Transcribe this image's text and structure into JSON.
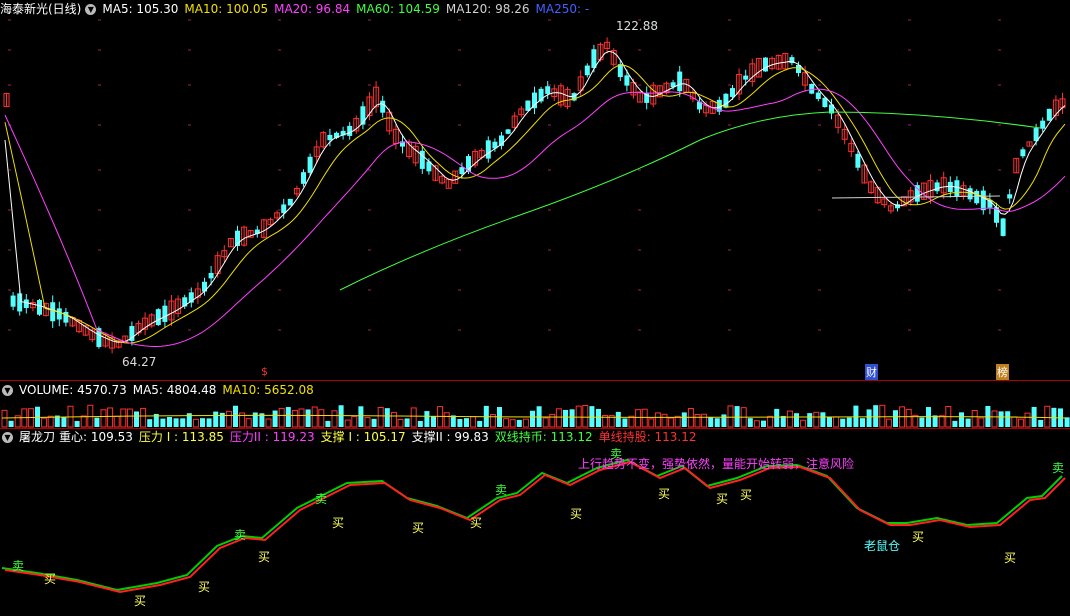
{
  "panel1": {
    "title": "海泰新光(日线)",
    "ma_items": [
      {
        "label": "MA5: 105.30",
        "color": "#ffffff"
      },
      {
        "label": "MA10: 100.05",
        "color": "#f0e000"
      },
      {
        "label": "MA20: 96.84",
        "color": "#ff40ff"
      },
      {
        "label": "MA60: 104.59",
        "color": "#40ff40"
      },
      {
        "label": "MA120: 98.26",
        "color": "#d0d0d0"
      },
      {
        "label": "MA250: -",
        "color": "#4060ff"
      }
    ],
    "high_label": "122.88",
    "low_label": "64.27",
    "markers": [
      "$",
      "财",
      "榜"
    ]
  },
  "panel2": {
    "title": "VOLUME: 4570.73",
    "ma5": "MA5: 4804.48",
    "ma10": "MA10: 5652.08"
  },
  "panel3": {
    "name": "屠龙刀",
    "items": [
      {
        "label": "重心: 109.53",
        "color": "#ffffff"
      },
      {
        "label": "压力 I : 113.85",
        "color": "#ffff40"
      },
      {
        "label": "压力II : 119.23",
        "color": "#ff40ff"
      },
      {
        "label": "支撑 I : 105.17",
        "color": "#ffff40"
      },
      {
        "label": "支撑II : 99.83",
        "color": "#ffffff"
      },
      {
        "label": "双线持币: 113.12",
        "color": "#40ff40"
      },
      {
        "label": "单线持股: 113.12",
        "color": "#ff3030"
      }
    ],
    "note": "上行趋势不变，强势依然，量能开始转弱，注意风险",
    "warn": "老鼠仓",
    "buy": "买",
    "sell": "卖"
  },
  "colors": {
    "up": "#ff3030",
    "down": "#54ffff",
    "green_line": "#00d000",
    "red_line": "#ff2020"
  }
}
